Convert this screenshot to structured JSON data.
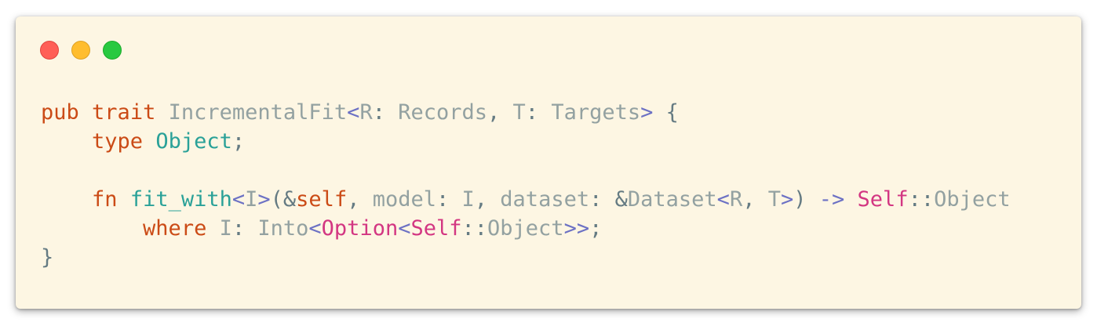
{
  "window": {
    "controls": [
      {
        "name": "close",
        "color": "#ff5f57",
        "border": "#e0443e"
      },
      {
        "name": "minimize",
        "color": "#ffbd2e",
        "border": "#dea123"
      },
      {
        "name": "zoom",
        "color": "#28c940",
        "border": "#1aab29"
      }
    ]
  },
  "code": {
    "lines": [
      [
        {
          "t": "pub",
          "c": "kw"
        },
        {
          "t": " ",
          "c": "plain"
        },
        {
          "t": "trait",
          "c": "kw"
        },
        {
          "t": " ",
          "c": "plain"
        },
        {
          "t": "IncrementalFit",
          "c": "ty"
        },
        {
          "t": "<",
          "c": "punct"
        },
        {
          "t": "R",
          "c": "ty"
        },
        {
          "t": ": ",
          "c": "plain"
        },
        {
          "t": "Records",
          "c": "ty"
        },
        {
          "t": ", ",
          "c": "plain"
        },
        {
          "t": "T",
          "c": "ty"
        },
        {
          "t": ": ",
          "c": "plain"
        },
        {
          "t": "Targets",
          "c": "ty"
        },
        {
          "t": ">",
          "c": "punct"
        },
        {
          "t": " {",
          "c": "plain"
        }
      ],
      [
        {
          "t": "    ",
          "c": "plain"
        },
        {
          "t": "type",
          "c": "kw"
        },
        {
          "t": " ",
          "c": "plain"
        },
        {
          "t": "Object",
          "c": "fn"
        },
        {
          "t": ";",
          "c": "plain"
        }
      ],
      [],
      [
        {
          "t": "    ",
          "c": "plain"
        },
        {
          "t": "fn",
          "c": "kw"
        },
        {
          "t": " ",
          "c": "plain"
        },
        {
          "t": "fit_with",
          "c": "fn"
        },
        {
          "t": "<",
          "c": "punct"
        },
        {
          "t": "I",
          "c": "ty"
        },
        {
          "t": ">",
          "c": "punct"
        },
        {
          "t": "(&",
          "c": "plain"
        },
        {
          "t": "self",
          "c": "kw"
        },
        {
          "t": ", ",
          "c": "plain"
        },
        {
          "t": "model",
          "c": "ident"
        },
        {
          "t": ": ",
          "c": "plain"
        },
        {
          "t": "I",
          "c": "ty"
        },
        {
          "t": ", ",
          "c": "plain"
        },
        {
          "t": "dataset",
          "c": "ident"
        },
        {
          "t": ": &",
          "c": "plain"
        },
        {
          "t": "Dataset",
          "c": "ty"
        },
        {
          "t": "<",
          "c": "punct"
        },
        {
          "t": "R",
          "c": "ty"
        },
        {
          "t": ", ",
          "c": "plain"
        },
        {
          "t": "T",
          "c": "ty"
        },
        {
          "t": ">",
          "c": "punct"
        },
        {
          "t": ") ",
          "c": "plain"
        },
        {
          "t": "->",
          "c": "punct"
        },
        {
          "t": " ",
          "c": "plain"
        },
        {
          "t": "Self",
          "c": "self"
        },
        {
          "t": "::",
          "c": "plain"
        },
        {
          "t": "Object",
          "c": "ty"
        }
      ],
      [
        {
          "t": "        ",
          "c": "plain"
        },
        {
          "t": "where",
          "c": "kw"
        },
        {
          "t": " ",
          "c": "plain"
        },
        {
          "t": "I",
          "c": "ty"
        },
        {
          "t": ": ",
          "c": "plain"
        },
        {
          "t": "Into",
          "c": "ty"
        },
        {
          "t": "<",
          "c": "punct"
        },
        {
          "t": "Option",
          "c": "self"
        },
        {
          "t": "<",
          "c": "punct"
        },
        {
          "t": "Self",
          "c": "self"
        },
        {
          "t": "::",
          "c": "plain"
        },
        {
          "t": "Object",
          "c": "ty"
        },
        {
          "t": ">>",
          "c": "punct"
        },
        {
          "t": ";",
          "c": "plain"
        }
      ],
      [
        {
          "t": "}",
          "c": "plain"
        }
      ]
    ]
  }
}
